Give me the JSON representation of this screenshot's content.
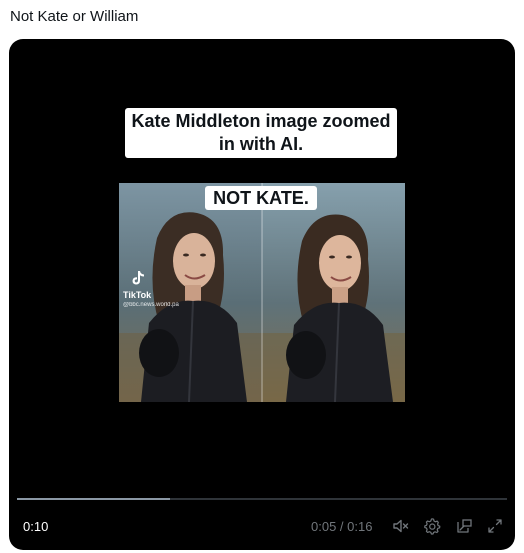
{
  "post": {
    "text": "Not Kate or William"
  },
  "video": {
    "caption_top_line1": "Kate Middleton image zoomed",
    "caption_top_line2": "in with AI.",
    "caption_middle": "NOT KATE.",
    "watermark": {
      "brand": "TikTok",
      "handle": "@bbc.news.world.pa"
    },
    "progress_fraction": 0.3125,
    "elapsed": "0:10",
    "time_readout": "0:05 / 0:16"
  },
  "controls": {
    "mute_icon": "speaker-muted-icon",
    "settings_icon": "gear-icon",
    "pip_icon": "picture-in-picture-icon",
    "fullscreen_icon": "expand-icon"
  },
  "colors": {
    "video_bg": "#000000",
    "caption_bg": "#ffffff",
    "control_gray": "#71767b"
  }
}
